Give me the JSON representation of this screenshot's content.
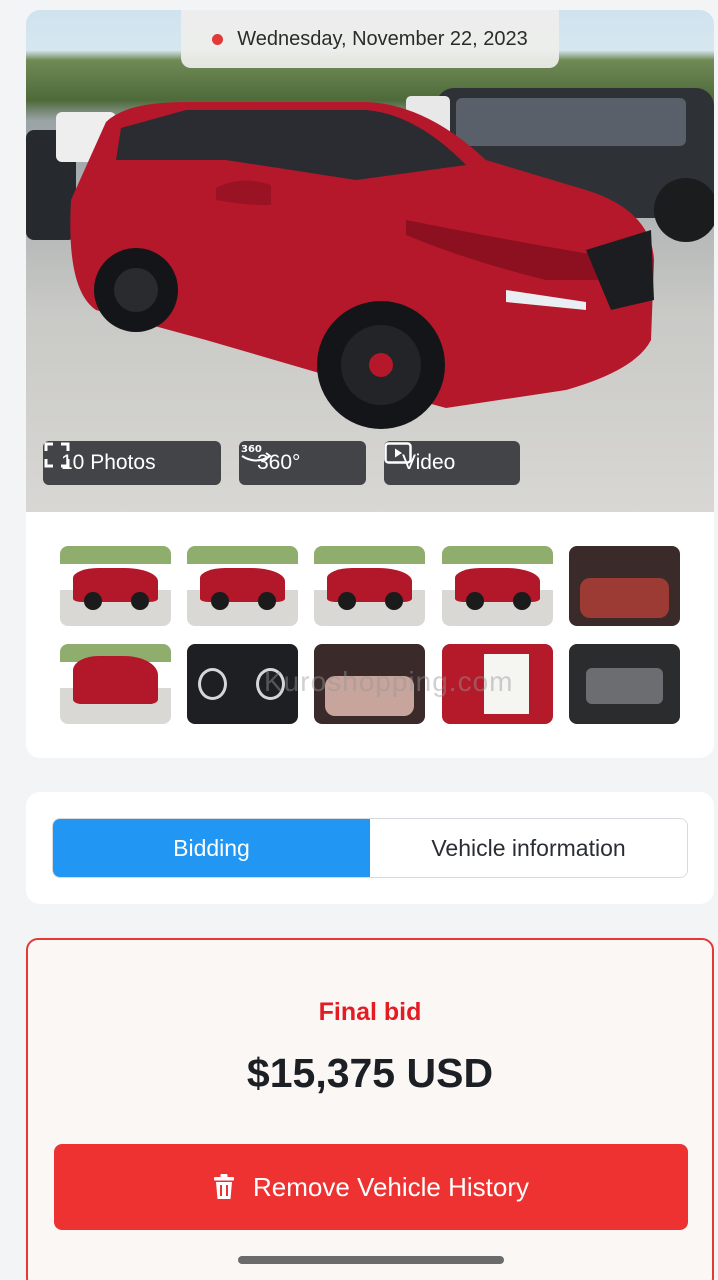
{
  "header": {
    "date": "Wednesday, November 22, 2023"
  },
  "media": {
    "photos_label": "10 Photos",
    "view360_label": "360°",
    "video_label": "Video"
  },
  "gallery": {
    "thumbnails": [
      {
        "kind": "exterior-front-left"
      },
      {
        "kind": "exterior-front"
      },
      {
        "kind": "exterior-rear"
      },
      {
        "kind": "exterior-rear-left"
      },
      {
        "kind": "interior-front"
      },
      {
        "kind": "exterior-side-damage"
      },
      {
        "kind": "dashboard"
      },
      {
        "kind": "interior-seats"
      },
      {
        "kind": "door-sticker"
      },
      {
        "kind": "engine-bay"
      }
    ],
    "watermark": "Kuroshopping.com",
    "icon_names": [
      "fullscreen-icon",
      "rotate-360-icon",
      "play-video-icon"
    ]
  },
  "tabs": {
    "bidding": "Bidding",
    "vehicle_info": "Vehicle information",
    "active": "bidding"
  },
  "bid": {
    "label": "Final bid",
    "amount": "$15,375 USD",
    "remove_button": "Remove Vehicle History",
    "remove_icon": "trash-icon"
  },
  "colors": {
    "accent_blue": "#2196f3",
    "danger_red": "#ee3231",
    "final_bid_red": "#e31b23",
    "date_dot": "#e53935"
  }
}
